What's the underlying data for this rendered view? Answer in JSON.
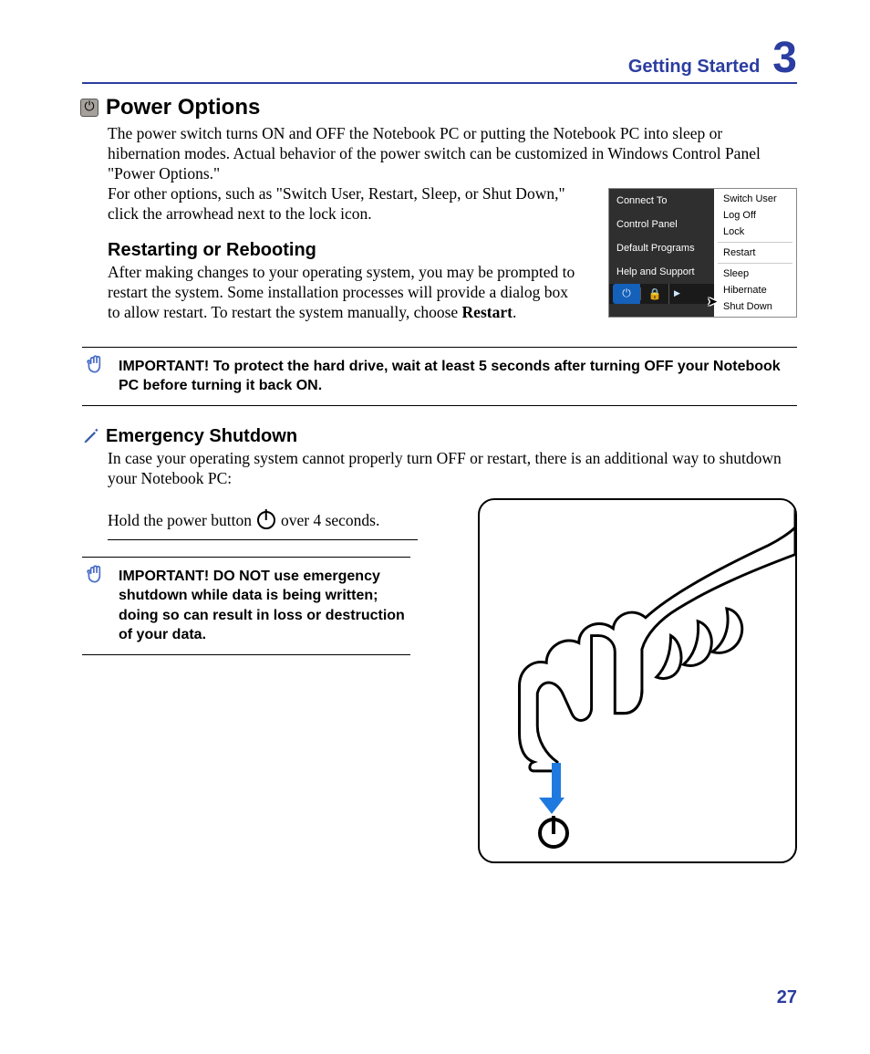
{
  "header": {
    "section": "Getting Started",
    "chapter": "3"
  },
  "h1": "Power Options",
  "p1": "The power switch turns ON and OFF the Notebook PC or putting the Notebook PC into sleep or hibernation modes. Actual behavior of the power switch can be customized in Windows Control Panel \"Power Options.\"",
  "p2a": "For other options, such as \"Switch User, Restart, Sleep, or Shut Down,\" click the arrowhead next to the lock icon.",
  "menu": {
    "left": [
      "Connect To",
      "Control Panel",
      "Default Programs",
      "Help and Support"
    ],
    "right": [
      "Switch User",
      "Log Off",
      "Lock",
      "Restart",
      "Sleep",
      "Hibernate",
      "Shut Down"
    ]
  },
  "h2a": "Restarting or Rebooting",
  "p3a": "After making changes to your operating system, you may be prompted to restart the system. Some installation processes will provide a dialog box to allow restart. To restart the system manually, choose ",
  "p3b": "Restart",
  "p3c": ".",
  "imp1": "IMPORTANT!  To protect the hard drive, wait at least 5 seconds after turning OFF your Notebook PC before turning it back ON.",
  "h2b": "Emergency Shutdown",
  "p4": "In case your operating system cannot properly turn OFF or restart, there is an additional way to shutdown your Notebook PC:",
  "hold_a": "Hold the power button",
  "hold_b": "over 4 seconds.",
  "imp2": "IMPORTANT!  DO NOT use emergency shutdown while data is being written; doing so can result in loss or destruction of your data.",
  "page": "27"
}
